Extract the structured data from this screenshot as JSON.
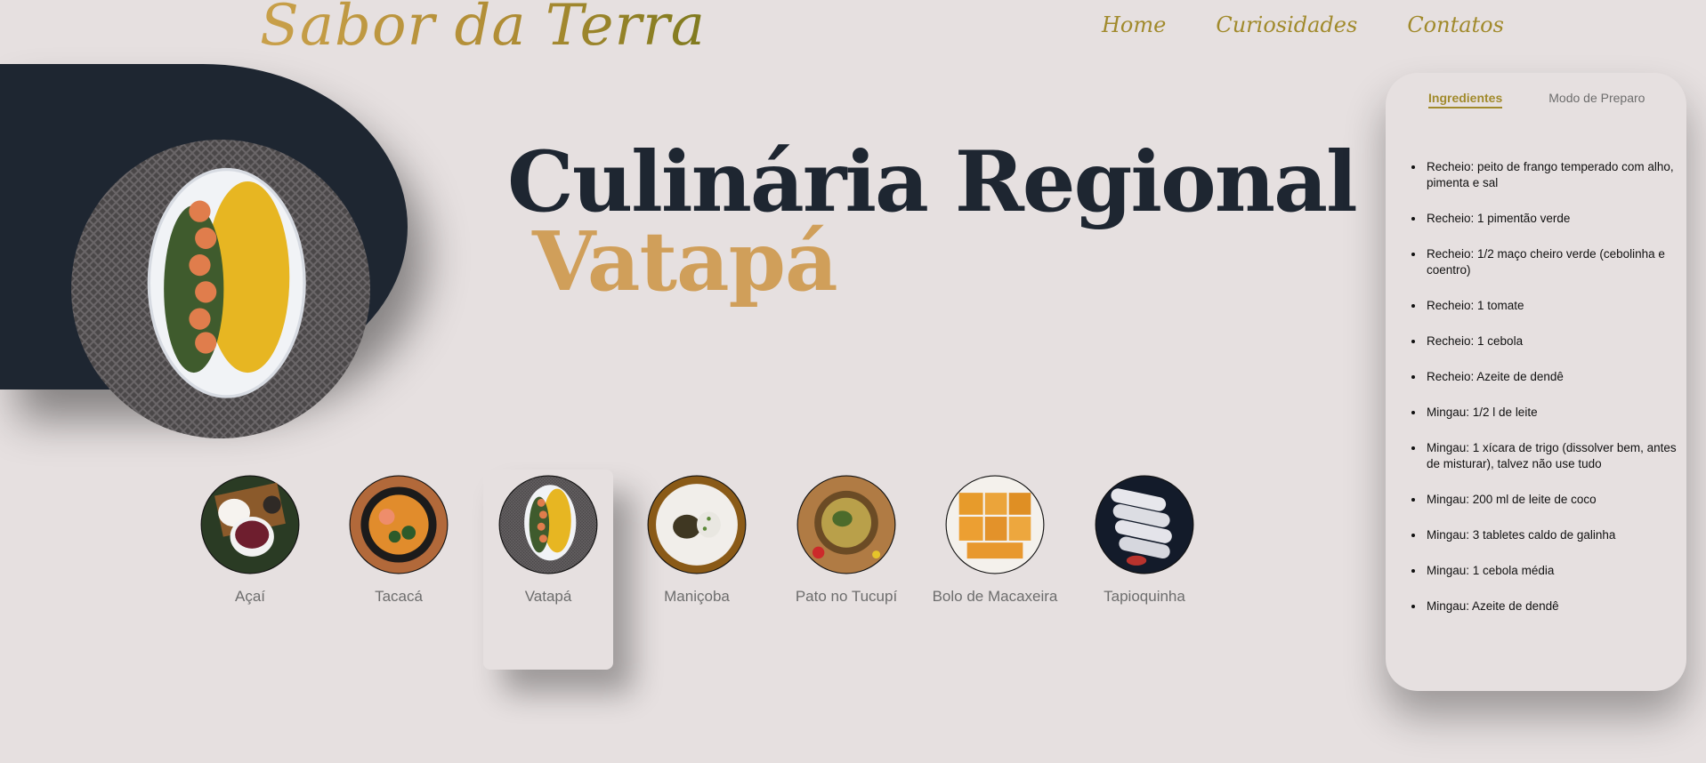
{
  "header": {
    "logo": "Sabor da Terra",
    "nav": [
      {
        "label": "Home"
      },
      {
        "label": "Curiosidades"
      },
      {
        "label": "Contatos"
      }
    ]
  },
  "hero": {
    "title": "Culinária Regional",
    "subtitle": "Vatapá"
  },
  "dishes": [
    {
      "label": "Açaí",
      "active": false
    },
    {
      "label": "Tacacá",
      "active": false
    },
    {
      "label": "Vatapá",
      "active": true
    },
    {
      "label": "Maniçoba",
      "active": false
    },
    {
      "label": "Pato no Tucupí",
      "active": false
    },
    {
      "label": "Bolo de Macaxeira",
      "active": false
    },
    {
      "label": "Tapioquinha",
      "active": false
    }
  ],
  "recipe": {
    "tabs": [
      {
        "label": "Ingredientes",
        "active": true
      },
      {
        "label": "Modo de Preparo",
        "active": false
      }
    ],
    "ingredients": [
      "Recheio: peito de frango temperado com alho, pimenta e sal",
      "Recheio: 1 pimentão verde",
      "Recheio: 1/2 maço cheiro verde (cebolinha e coentro)",
      "Recheio: 1 tomate",
      "Recheio: 1 cebola",
      "Recheio: Azeite de dendê",
      "Mingau: 1/2 l de leite",
      "Mingau: 1 xícara de trigo (dissolver bem, antes de misturar), talvez não use tudo",
      "Mingau: 200 ml de leite de coco",
      "Mingau: 3 tabletes caldo de galinha",
      "Mingau: 1 cebola média",
      "Mingau: Azeite de dendê"
    ]
  },
  "colors": {
    "background": "#e6e0e0",
    "navy": "#1e2631",
    "gold": "#a18a2c",
    "accent_orange": "#d09f5a",
    "muted_text": "#6d6d6d"
  },
  "icons": {
    "acai": "acai-bowl-icon",
    "tacaca": "tacaca-bowl-icon",
    "vatapa": "vatapa-plate-icon",
    "manicoba": "manicoba-plate-icon",
    "pato": "pato-no-tucupi-icon",
    "bolo": "bolo-de-macaxeira-icon",
    "tapioca": "tapioquinha-icon"
  }
}
